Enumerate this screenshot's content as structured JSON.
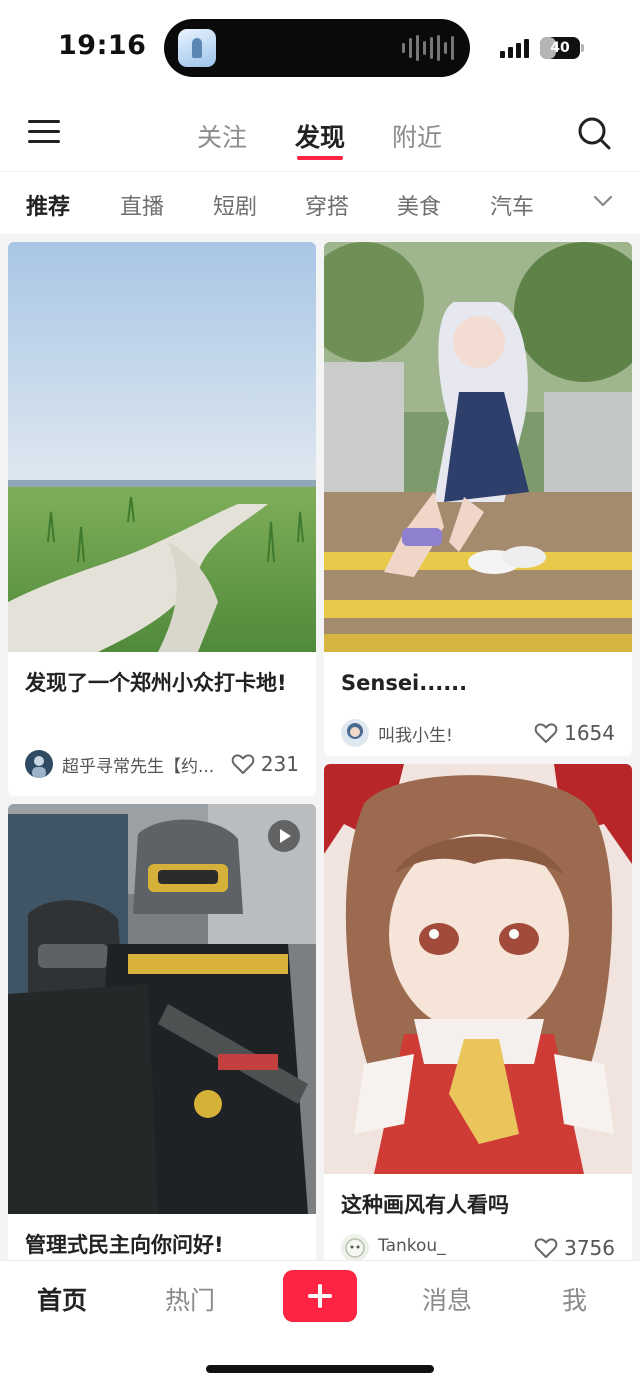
{
  "status_bar": {
    "time": "19:16",
    "battery": "40",
    "battery_level": 0.4,
    "island_app_icon": "app-icon",
    "island_activity_icon": "audio-wave-icon"
  },
  "top_nav": {
    "menu_icon": "menu-icon",
    "tabs": [
      "关注",
      "发现",
      "附近"
    ],
    "active_tab": "发现",
    "search_icon": "search-icon",
    "accent_color": "#ff2442"
  },
  "categories": {
    "items": [
      "推荐",
      "直播",
      "短剧",
      "穿搭",
      "美食",
      "汽车"
    ],
    "active": "推荐",
    "expand_icon": "chevron-down-icon"
  },
  "feed": {
    "cards": [
      {
        "title": "发现了一个郑州小众打卡地!",
        "author": "超乎寻常先生【约...",
        "likes": "231",
        "image": "grassland-photo"
      },
      {
        "title": "Sensei......",
        "author": "叫我小生!",
        "likes": "1654",
        "image": "cosplay-photo"
      },
      {
        "title": "管理式民主向你问好!",
        "author": "",
        "likes": "",
        "image": "armor-cosplay-photo",
        "video": true
      },
      {
        "title": "这种画风有人看吗",
        "author": "Tankou_",
        "likes": "3756",
        "image": "anime-illustration"
      }
    ]
  },
  "bottom_bar": {
    "tabs": [
      "首页",
      "热门",
      "消息",
      "我"
    ],
    "active": "首页",
    "add_icon": "plus-icon"
  }
}
